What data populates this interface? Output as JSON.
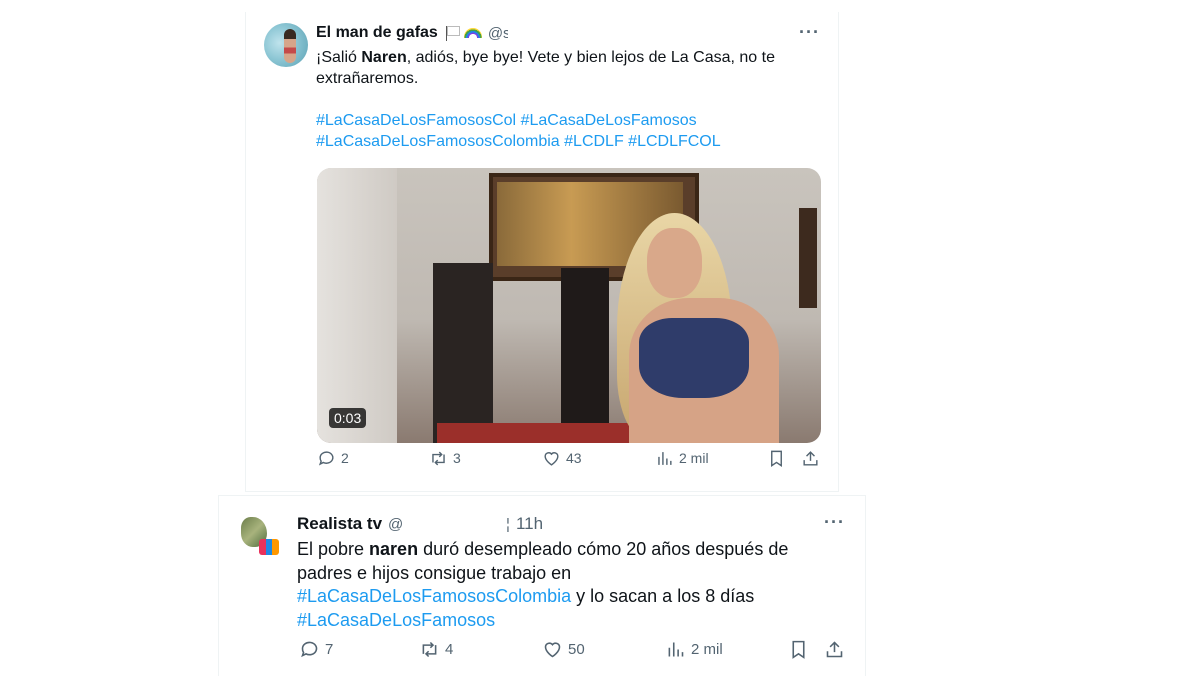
{
  "tweets": [
    {
      "name": "El man de gafas",
      "handle": "@s",
      "text_parts": [
        "¡Salió ",
        "Naren",
        ", adiós, bye bye! Vete y bien lejos de La Casa, no te extrañaremos."
      ],
      "hashtags_line1": [
        "#LaCasaDeLosFamososCol",
        "#LaCasaDeLosFamosos"
      ],
      "hashtags_line2": [
        "#LaCasaDeLosFamososColombia",
        "#LCDLF",
        "#LCDLFCOL"
      ],
      "video_duration": "0:03",
      "replies": "2",
      "reposts": "3",
      "likes": "43",
      "views": "2 mil"
    },
    {
      "name": "Realista tv",
      "handle": "@",
      "separator": "¦",
      "time": "11h",
      "text_a": "El pobre ",
      "text_b": "naren",
      "text_c": " duró desempleado cómo 20 años después de padres e hijos consigue trabajo en ",
      "hashtag_a": "#LaCasaDeLosFamososColombia",
      "text_d": " y lo sacan a los 8 días",
      "hashtag_b": "#LaCasaDeLosFamosos",
      "replies": "7",
      "reposts": "4",
      "likes": "50",
      "views": "2 mil"
    }
  ],
  "colors": {
    "link": "#1d9bf0",
    "muted": "#536471",
    "text": "#0f1419"
  },
  "icons": [
    "reply-icon",
    "repost-icon",
    "like-icon",
    "views-icon",
    "bookmark-icon",
    "share-icon",
    "more-icon",
    "flag-icon",
    "rainbow-icon"
  ]
}
